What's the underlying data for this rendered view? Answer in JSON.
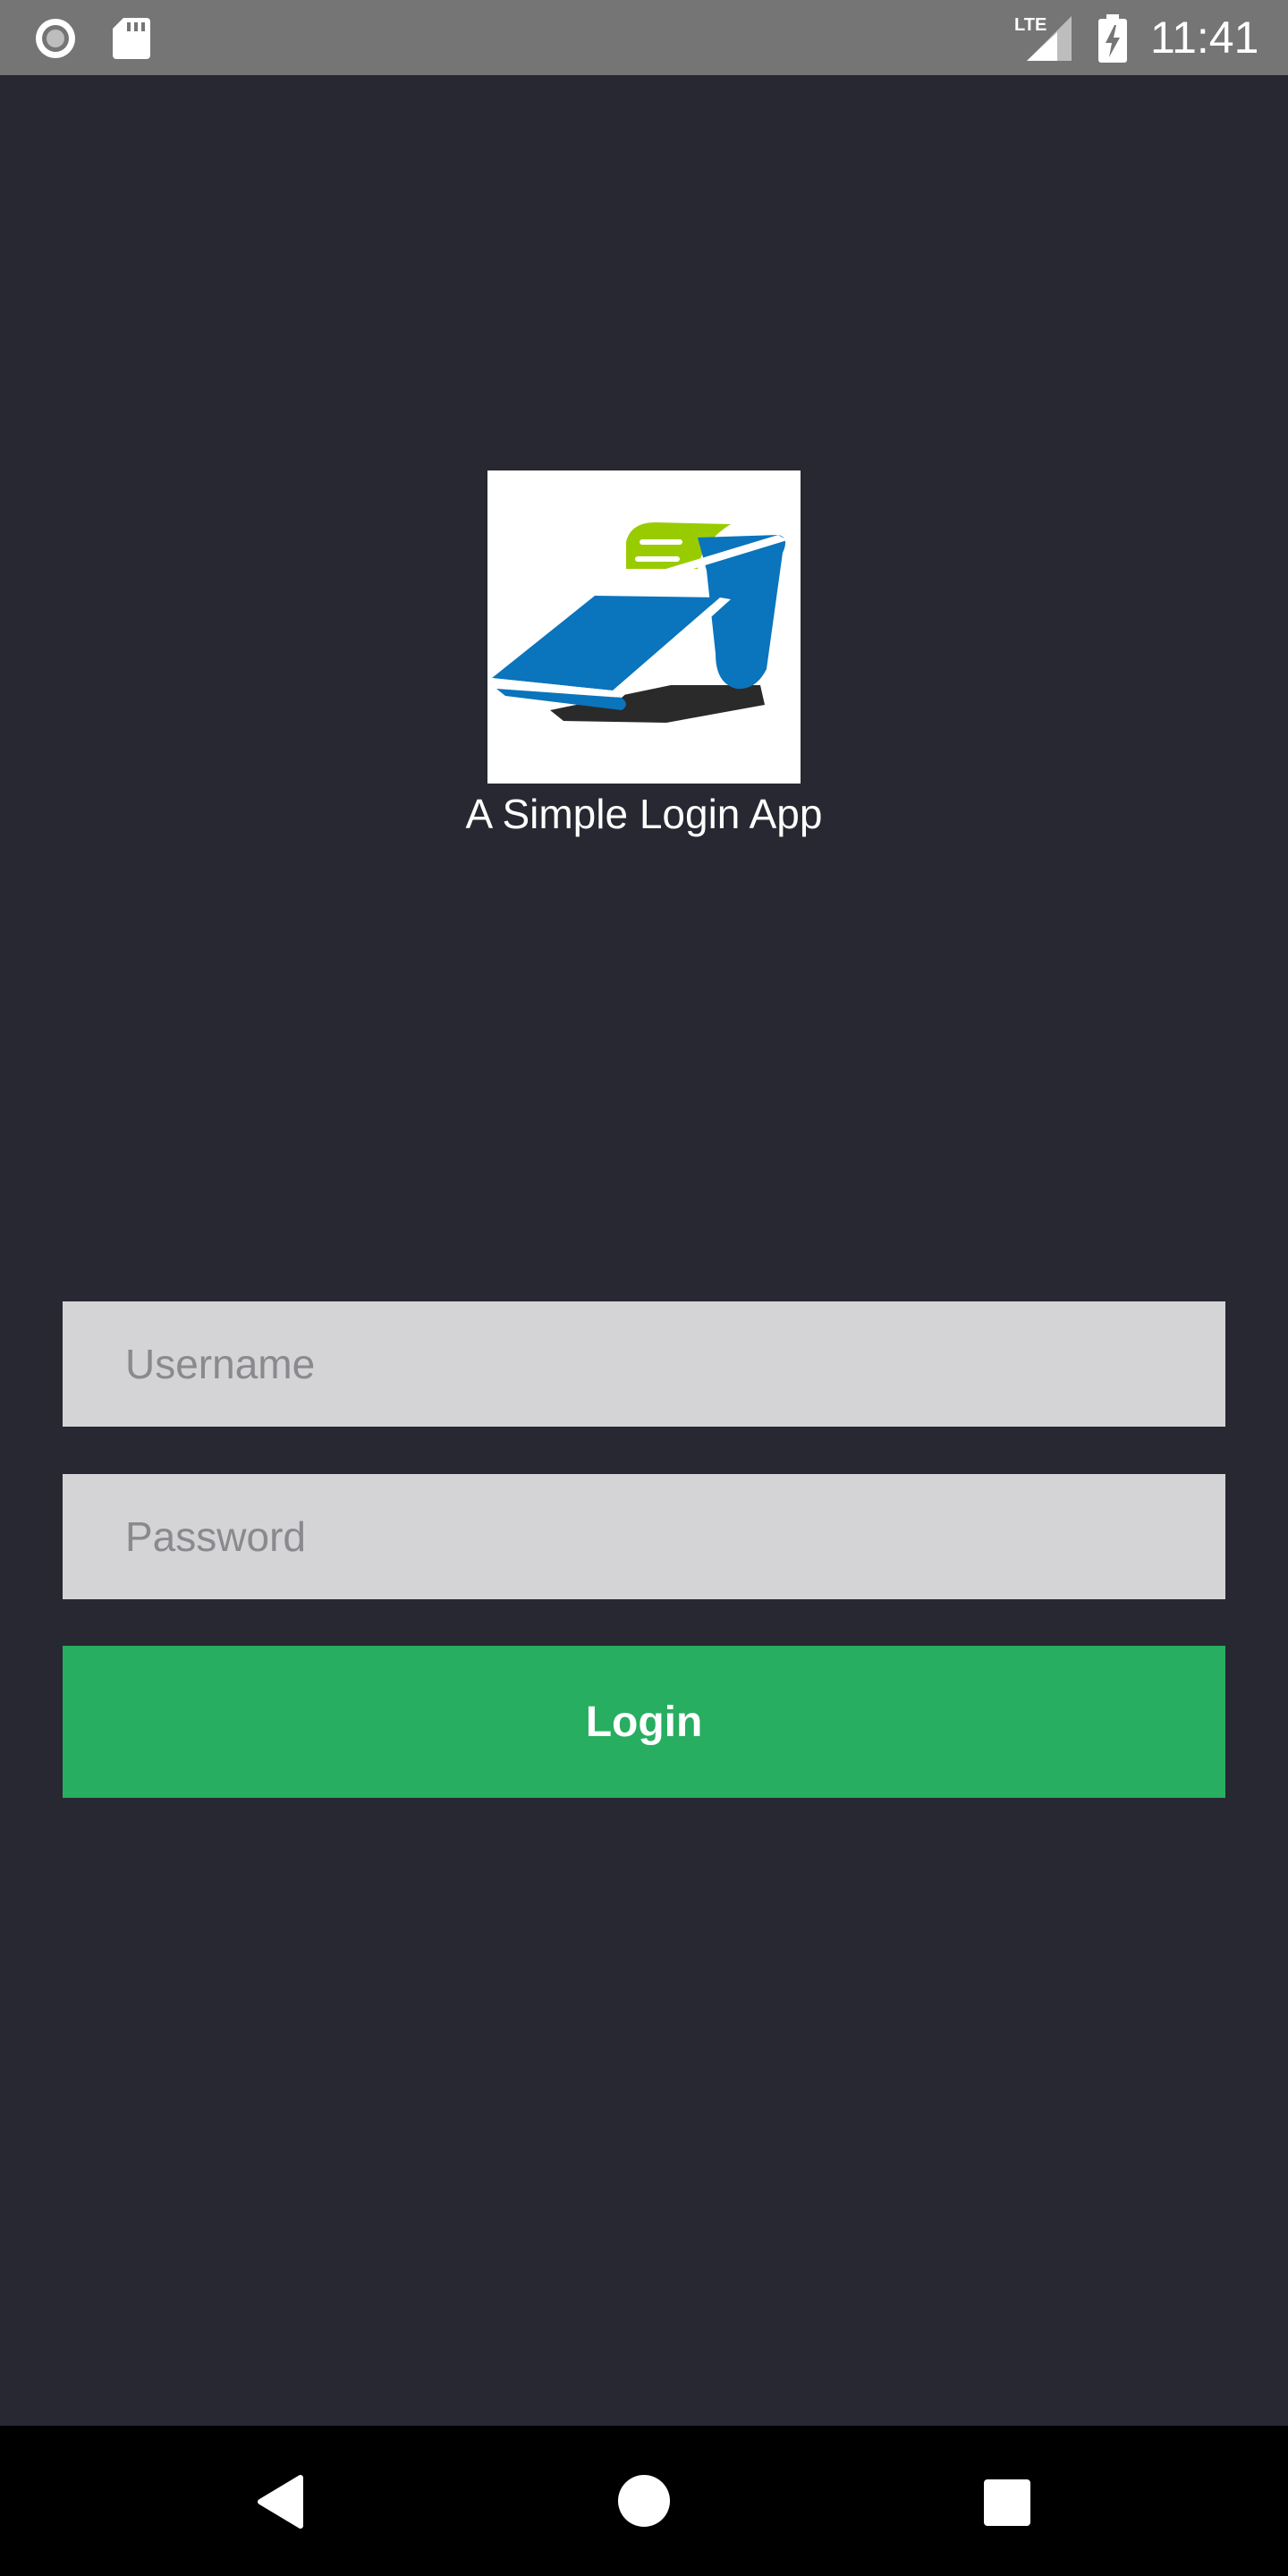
{
  "status_bar": {
    "time": "11:41",
    "network_label": "LTE",
    "icons": [
      "record-icon",
      "sdcard-icon",
      "lte-signal-icon",
      "battery-charging-icon"
    ]
  },
  "app": {
    "title": "A Simple Login App",
    "logo": "receipt-printer-logo"
  },
  "form": {
    "username_placeholder": "Username",
    "username_value": "",
    "password_placeholder": "Password",
    "password_value": "",
    "login_label": "Login"
  },
  "nav_bar": {
    "icons": [
      "back-icon",
      "home-icon",
      "recents-icon"
    ]
  },
  "colors": {
    "background": "#272831",
    "status_bar": "#757575",
    "input_bg": "#d4d4d6",
    "login_button": "#27ae60",
    "logo_blue": "#0a74bc",
    "logo_green": "#99cc00"
  }
}
